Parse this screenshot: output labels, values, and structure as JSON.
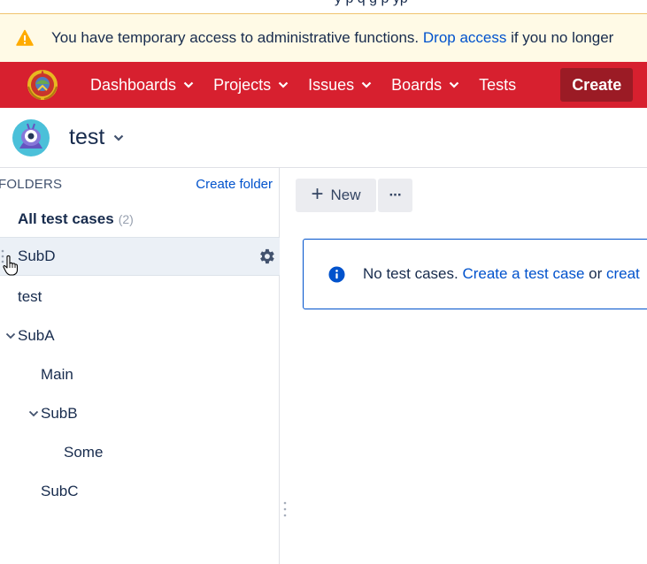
{
  "top_strip": {
    "clipped_text": "y p q g p yp"
  },
  "banner": {
    "text_before": "You have temporary access to administrative functions. ",
    "link": "Drop access",
    "text_after": " if you no longer"
  },
  "nav": {
    "items": [
      {
        "label": "Dashboards",
        "has_dropdown": true
      },
      {
        "label": "Projects",
        "has_dropdown": true
      },
      {
        "label": "Issues",
        "has_dropdown": true
      },
      {
        "label": "Boards",
        "has_dropdown": true
      },
      {
        "label": "Tests",
        "has_dropdown": false
      }
    ],
    "create_label": "Create",
    "colors": {
      "bar": "#d7202f",
      "create_bg": "#9b1b25"
    }
  },
  "project": {
    "name": "test"
  },
  "sidebar": {
    "header_label": "FOLDERS",
    "create_folder_label": "Create folder",
    "all_cases_label": "All test cases",
    "all_cases_count": "(2)",
    "tree": [
      {
        "label": "SubD",
        "selected": true
      },
      {
        "label": "test"
      },
      {
        "label": "SubA",
        "expanded": true
      },
      {
        "label": "Main"
      },
      {
        "label": "SubB",
        "expanded": true
      },
      {
        "label": "Some"
      },
      {
        "label": "SubC"
      }
    ]
  },
  "toolbar": {
    "new_label": "New",
    "more_label": "···"
  },
  "empty_state": {
    "text_before": "No test cases. ",
    "link1": "Create a test case",
    "middle": " or ",
    "link2": "creat"
  }
}
